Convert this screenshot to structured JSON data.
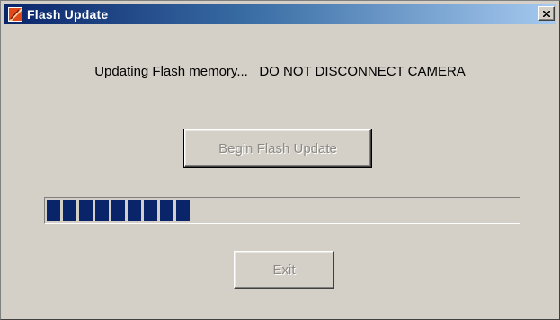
{
  "window": {
    "title": "Flash Update",
    "icon": "flash-update-app-icon",
    "close_icon": "close-icon"
  },
  "main": {
    "message": "Updating Flash memory...   DO NOT DISCONNECT CAMERA",
    "begin_button_label": "Begin Flash Update",
    "exit_button_label": "Exit",
    "progress": {
      "fraction": 0.31,
      "color": "#0a246a"
    }
  }
}
